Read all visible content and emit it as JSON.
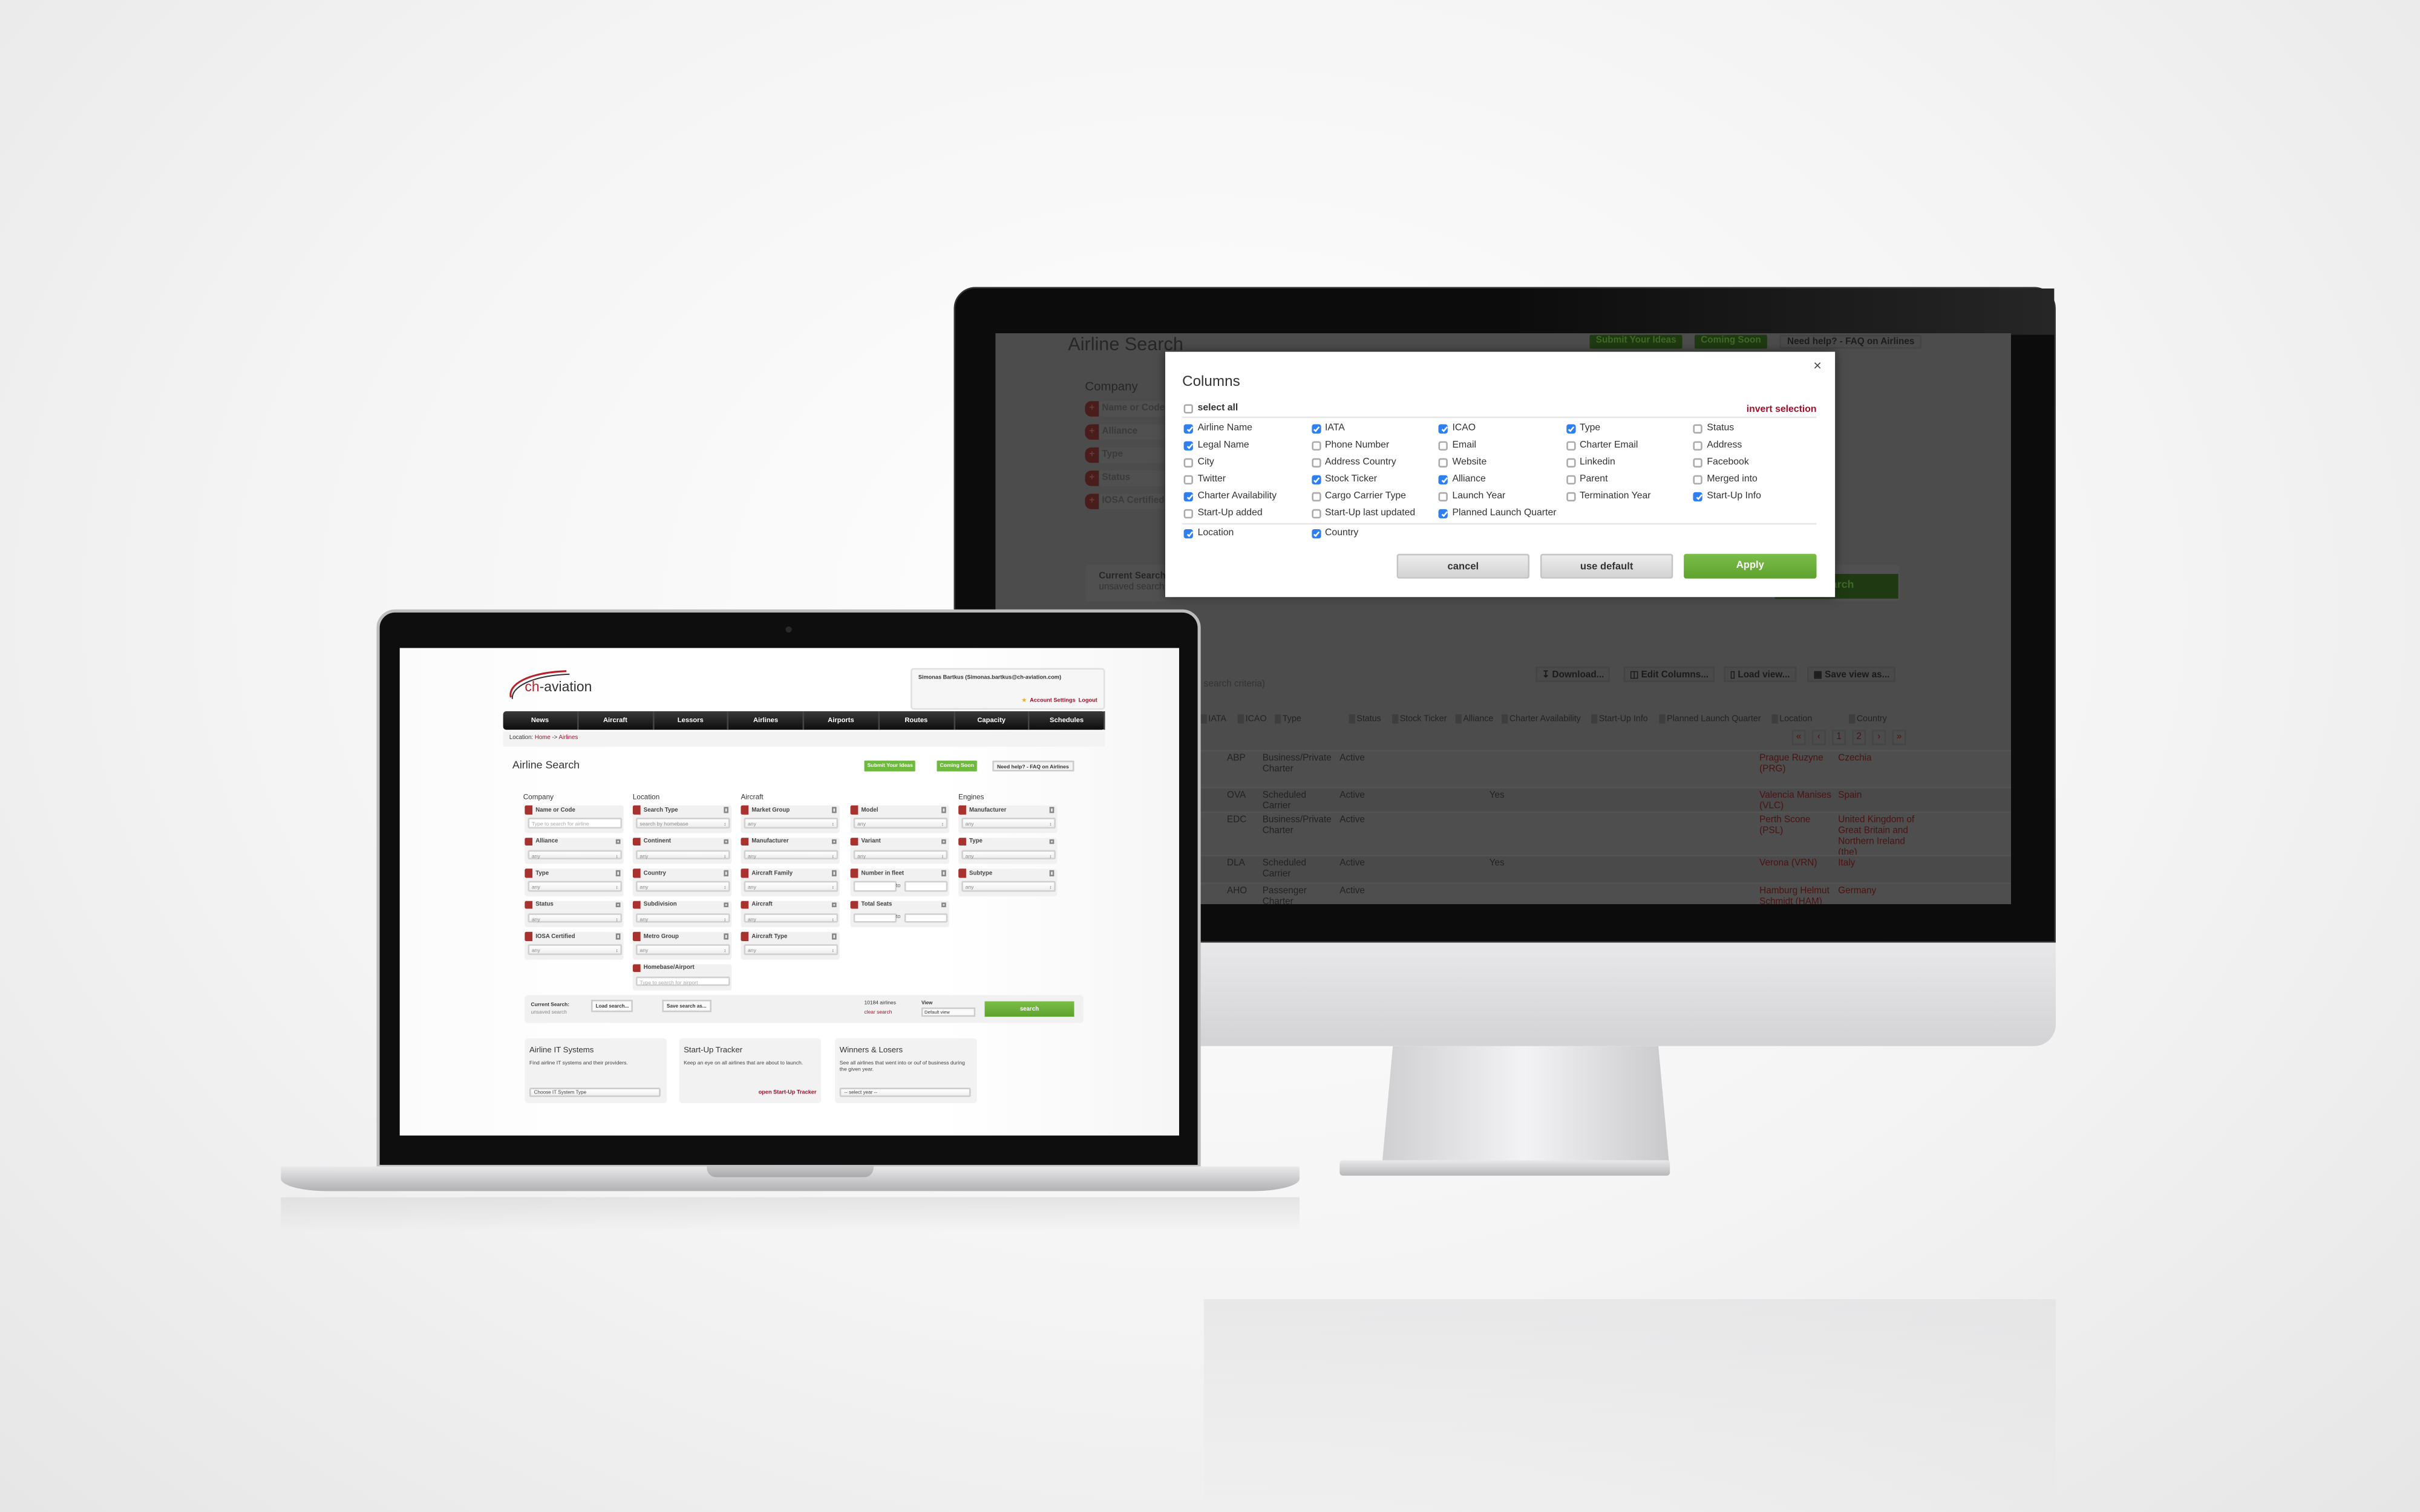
{
  "monitor": {
    "page_title": "Airline Search",
    "header_buttons": [
      "Submit Your Ideas",
      "Coming Soon",
      "Need help? - FAQ on Airlines"
    ],
    "company_heading": "Company",
    "company_filters": [
      "Name or Code",
      "Alliance",
      "Type",
      "Status",
      "IOSA Certified"
    ],
    "current_search_label": "Current Search:",
    "current_search_value": "unsaved search",
    "search_button": "search",
    "criteria_note": "search criteria)",
    "toolbar": [
      "Download...",
      "Edit Columns...",
      "Load view...",
      "Save view as..."
    ],
    "table_headers": [
      "IATA",
      "ICAO",
      "Type",
      "Status",
      "Stock Ticker",
      "Alliance",
      "Charter Availability",
      "Start-Up Info",
      "Planned Launch Quarter",
      "Location",
      "Country"
    ],
    "pagination": [
      "«",
      "‹",
      "1",
      "2",
      "›",
      "»"
    ],
    "rows": [
      {
        "icao": "ABP",
        "type": "Business/Private Charter",
        "status": "Active",
        "charter": "",
        "location": "Prague Ruzyne (PRG)",
        "country": "Czechia"
      },
      {
        "icao": "OVA",
        "type": "Scheduled Carrier",
        "status": "Active",
        "charter": "Yes",
        "location": "Valencia Manises (VLC)",
        "country": "Spain"
      },
      {
        "icao": "EDC",
        "type": "Business/Private Charter",
        "status": "Active",
        "charter": "",
        "location": "Perth Scone (PSL)",
        "country": "United Kingdom of Great Britain and Northern Ireland (the)"
      },
      {
        "icao": "DLA",
        "type": "Scheduled Carrier",
        "status": "Active",
        "charter": "Yes",
        "location": "Verona (VRN)",
        "country": "Italy"
      },
      {
        "icao": "AHO",
        "type": "Passenger Charter",
        "status": "Active",
        "charter": "",
        "location": "Hamburg Helmut Schmidt (HAM)",
        "country": "Germany"
      }
    ]
  },
  "modal": {
    "title": "Columns",
    "close": "×",
    "select_all": {
      "label": "select all",
      "checked": false
    },
    "invert_selection": "invert selection",
    "columns": [
      {
        "label": "Airline Name",
        "checked": true
      },
      {
        "label": "IATA",
        "checked": true
      },
      {
        "label": "ICAO",
        "checked": true
      },
      {
        "label": "Type",
        "checked": true
      },
      {
        "label": "Status",
        "checked": false
      },
      {
        "label": "Legal Name",
        "checked": true
      },
      {
        "label": "Phone Number",
        "checked": false
      },
      {
        "label": "Email",
        "checked": false
      },
      {
        "label": "Charter Email",
        "checked": false
      },
      {
        "label": "Address",
        "checked": false
      },
      {
        "label": "City",
        "checked": false
      },
      {
        "label": "Address Country",
        "checked": false
      },
      {
        "label": "Website",
        "checked": false
      },
      {
        "label": "Linkedin",
        "checked": false
      },
      {
        "label": "Facebook",
        "checked": false
      },
      {
        "label": "Twitter",
        "checked": false
      },
      {
        "label": "Stock Ticker",
        "checked": true
      },
      {
        "label": "Alliance",
        "checked": true
      },
      {
        "label": "Parent",
        "checked": false
      },
      {
        "label": "Merged into",
        "checked": false
      },
      {
        "label": "Charter Availability",
        "checked": true
      },
      {
        "label": "Cargo Carrier Type",
        "checked": false
      },
      {
        "label": "Launch Year",
        "checked": false
      },
      {
        "label": "Termination Year",
        "checked": false
      },
      {
        "label": "Start-Up Info",
        "checked": true
      },
      {
        "label": "Start-Up added",
        "checked": false
      },
      {
        "label": "Start-Up last updated",
        "checked": false
      },
      {
        "label": "Planned Launch Quarter",
        "checked": true
      }
    ],
    "fixed_columns": [
      {
        "label": "Location",
        "checked": true
      },
      {
        "label": "Country",
        "checked": true
      }
    ],
    "buttons": {
      "cancel": "cancel",
      "use_default": "use default",
      "apply": "Apply"
    }
  },
  "laptop": {
    "logo": "ch-aviation",
    "user": "Simonas Bartkus (Simonas.bartkus@ch-aviation.com)",
    "account_settings": "Account Settings",
    "logout": "Logout",
    "nav": [
      "News",
      "Aircraft",
      "Lessors",
      "Airlines",
      "Airports",
      "Routes",
      "Capacity",
      "Schedules"
    ],
    "breadcrumb": {
      "label": "Location:",
      "home": "Home",
      "sep": "->",
      "current": "Airlines"
    },
    "page_title": "Airline Search",
    "header_buttons": [
      "Submit Your Ideas",
      "Coming Soon",
      "Need help? - FAQ on Airlines"
    ],
    "section_headings": [
      "Company",
      "Location",
      "Aircraft",
      "Engines"
    ],
    "filter_columns": [
      [
        {
          "label": "Name or Code",
          "kind": "input",
          "value": "Type to search for airline"
        },
        {
          "label": "Alliance",
          "value": "any"
        },
        {
          "label": "Type",
          "value": "any"
        },
        {
          "label": "Status",
          "value": "any"
        },
        {
          "label": "IOSA Certified",
          "value": "any"
        }
      ],
      [
        {
          "label": "Search Type",
          "value": "search by homebase"
        },
        {
          "label": "Continent",
          "value": "any"
        },
        {
          "label": "Country",
          "value": "any"
        },
        {
          "label": "Subdivision",
          "value": "any"
        },
        {
          "label": "Metro Group",
          "value": "any"
        },
        {
          "label": "Homebase/Airport",
          "kind": "input",
          "value": "Type to search for airport"
        }
      ],
      [
        {
          "label": "Market Group",
          "value": "any"
        },
        {
          "label": "Manufacturer",
          "value": "any"
        },
        {
          "label": "Aircraft Family",
          "value": "any"
        },
        {
          "label": "Aircraft",
          "value": "any"
        },
        {
          "label": "Aircraft Type",
          "value": "any"
        }
      ],
      [
        {
          "label": "Model",
          "value": "any"
        },
        {
          "label": "Variant",
          "value": "any"
        },
        {
          "label": "Number in fleet",
          "kind": "range",
          "value": "to"
        },
        {
          "label": "Total Seats",
          "kind": "range",
          "value": "to"
        }
      ],
      [
        {
          "label": "Manufacturer",
          "value": "any"
        },
        {
          "label": "Type",
          "value": "any"
        },
        {
          "label": "Subtype",
          "value": "any"
        }
      ]
    ],
    "current_search_label": "Current Search:",
    "current_search_value": "unsaved search",
    "load_search": "Load search...",
    "save_search": "Save search as...",
    "result_count": "10184 airlines",
    "clear_search": "clear search",
    "view_label": "View",
    "view_value": "Default view",
    "search_button": "search",
    "cards": [
      {
        "title": "Airline IT Systems",
        "text": "Find airline IT systems and their providers.",
        "select": "Choose IT System Type"
      },
      {
        "title": "Start-Up Tracker",
        "text": "Keep an eye on all airlines that are about to launch.",
        "link": "open Start-Up Tracker"
      },
      {
        "title": "Winners & Losers",
        "text": "See all airlines that went into or ouf of business during the given year.",
        "select": "-- select year --"
      }
    ]
  },
  "colors": {
    "accent_red": "#a0102a",
    "green": "#6fba3e",
    "checkbox_blue": "#2f7ff0"
  }
}
